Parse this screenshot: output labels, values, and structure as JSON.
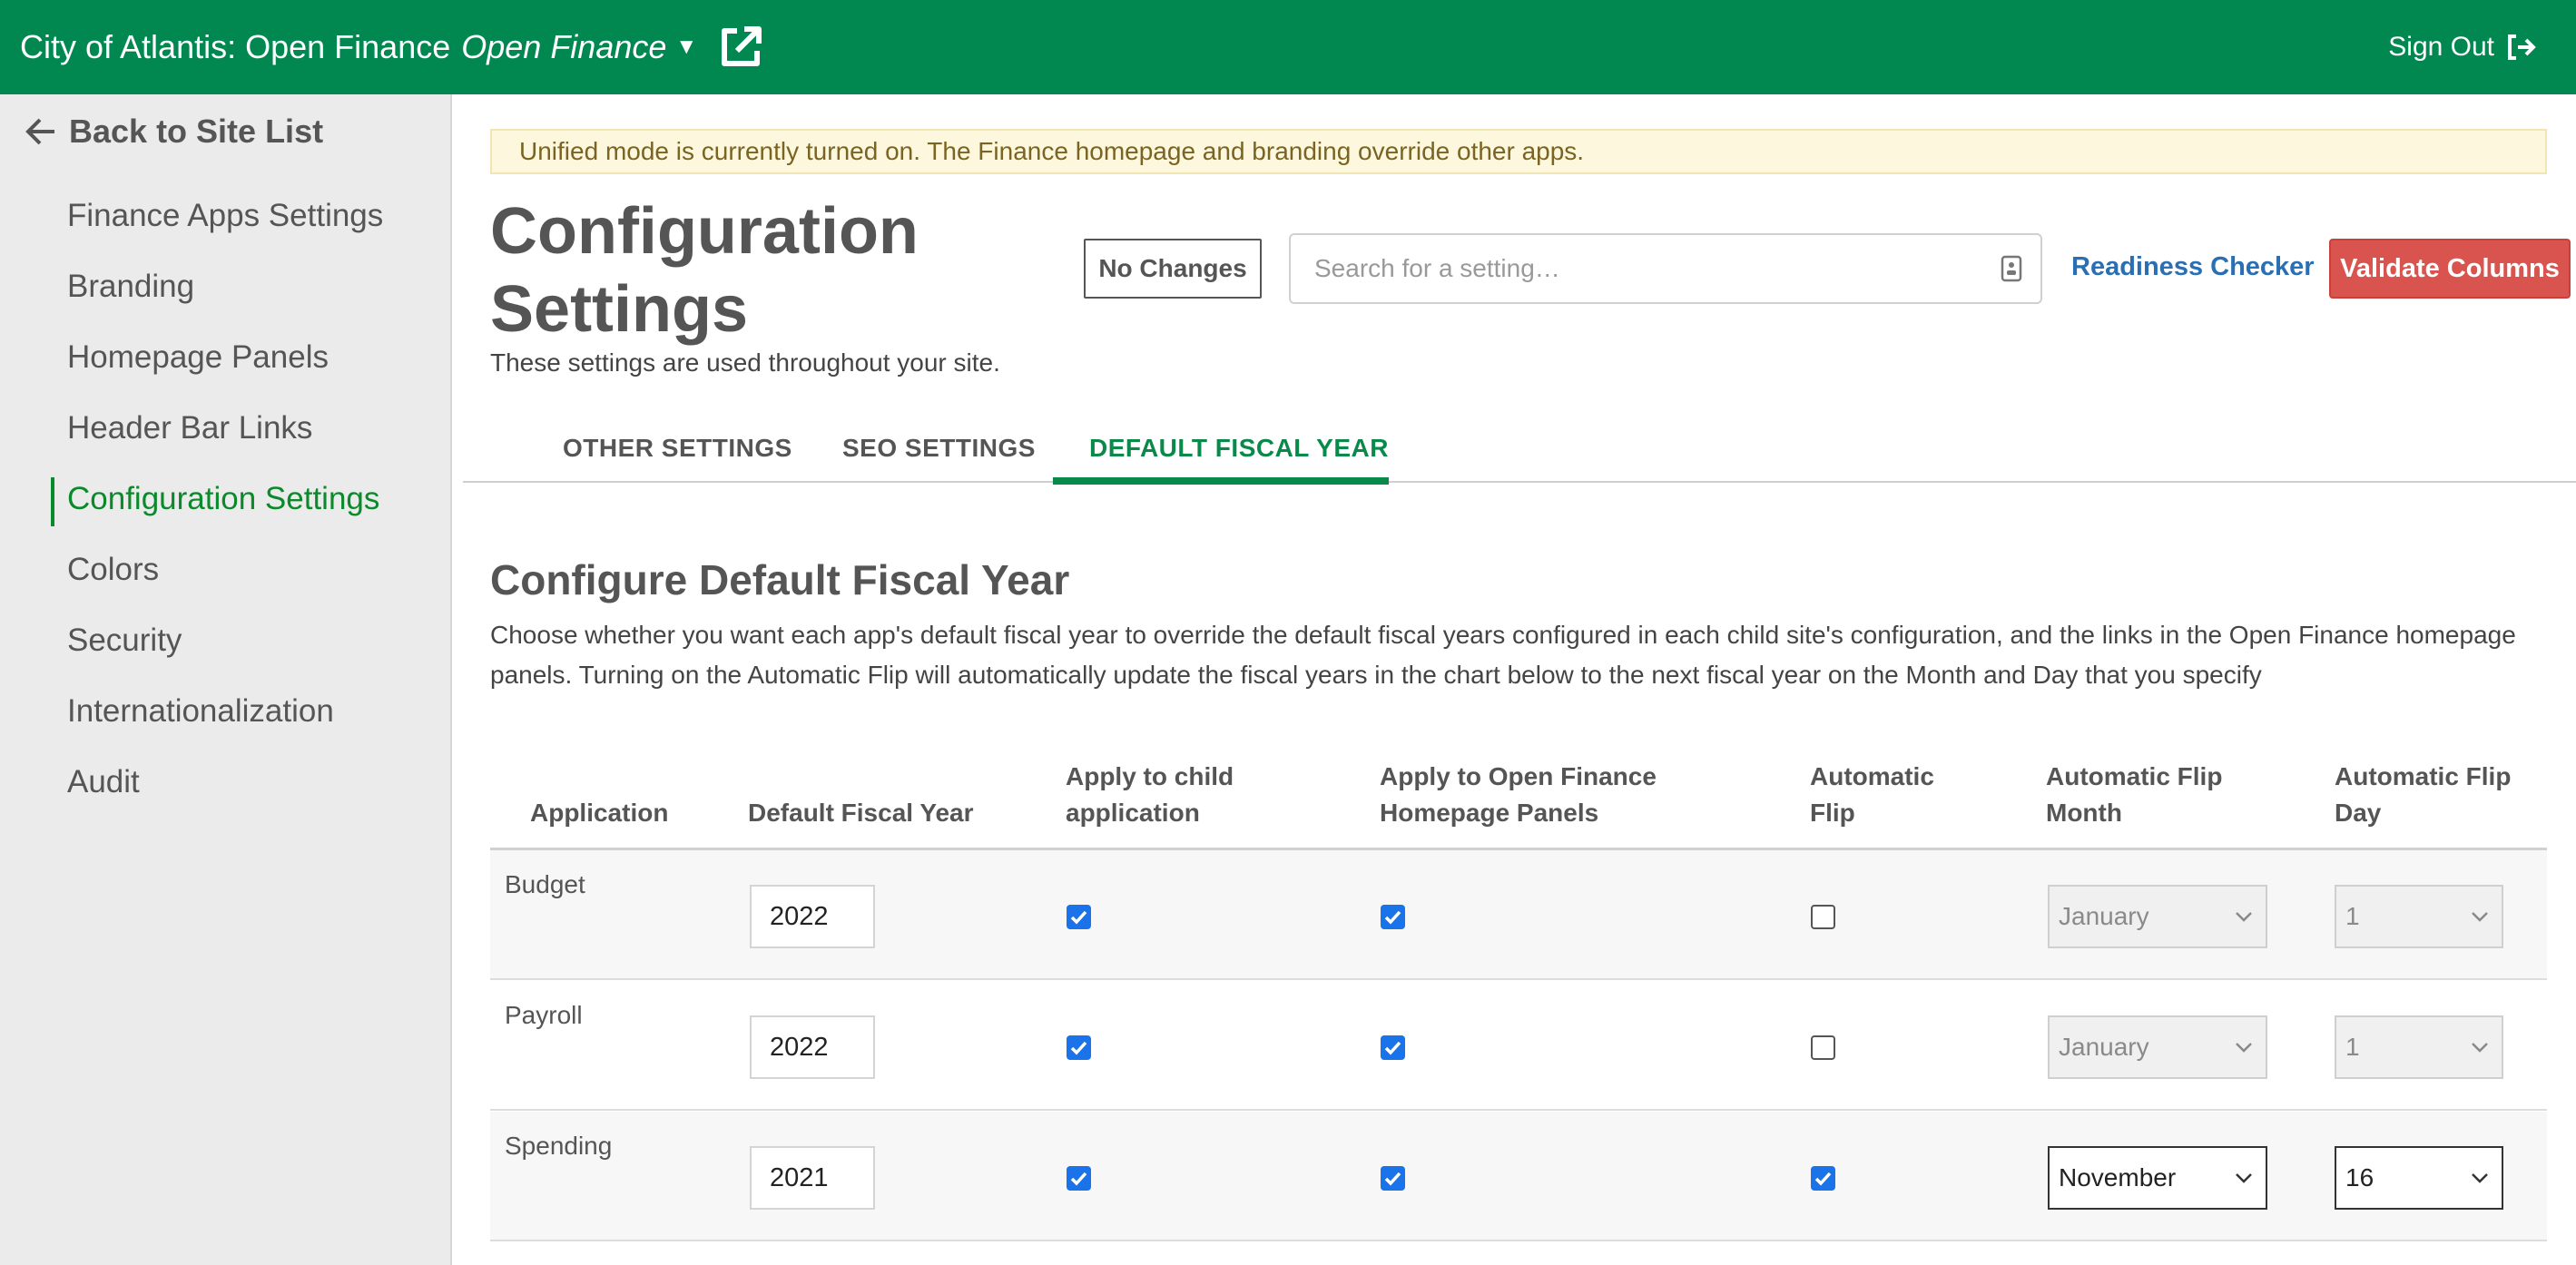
{
  "header": {
    "site_title": "City of Atlantis: Open Finance",
    "app_name": "Open Finance",
    "sign_out": "Sign Out"
  },
  "sidebar": {
    "back_label": "Back to Site List",
    "items": [
      {
        "label": "Finance Apps Settings"
      },
      {
        "label": "Branding"
      },
      {
        "label": "Homepage Panels"
      },
      {
        "label": "Header Bar Links"
      },
      {
        "label": "Configuration Settings",
        "active": true
      },
      {
        "label": "Colors"
      },
      {
        "label": "Security"
      },
      {
        "label": "Internationalization"
      },
      {
        "label": "Audit"
      }
    ]
  },
  "banner": {
    "text": "Unified mode is currently turned on. The Finance homepage and branding override other apps."
  },
  "page": {
    "title": "Configuration Settings",
    "subtitle": "These settings are used throughout your site."
  },
  "toolbar": {
    "no_changes_label": "No Changes",
    "search_placeholder": "Search for a setting…",
    "readiness_label": "Readiness Checker",
    "validate_label": "Validate Columns"
  },
  "tabs": [
    {
      "label": "OTHER SETTINGS"
    },
    {
      "label": "SEO SETTINGS"
    },
    {
      "label": "DEFAULT FISCAL YEAR",
      "active": true
    }
  ],
  "section": {
    "title": "Configure Default Fiscal Year",
    "description": "Choose whether you want each app's default fiscal year to override the default fiscal years configured in each child site's configuration, and the links in the Open Finance homepage panels. Turning on the Automatic Flip will automatically update the fiscal years in the chart below to the next fiscal year on the Month and Day that you specify"
  },
  "table": {
    "columns": [
      "Application",
      "Default Fiscal Year",
      "Apply to child application",
      "Apply to Open Finance Homepage Panels",
      "Automatic Flip",
      "Automatic Flip Month",
      "Automatic Flip Day"
    ],
    "rows": [
      {
        "application": "Budget",
        "year": "2022",
        "apply_child": true,
        "apply_homepage": true,
        "auto_flip": false,
        "month": "January",
        "day": "1"
      },
      {
        "application": "Payroll",
        "year": "2022",
        "apply_child": true,
        "apply_homepage": true,
        "auto_flip": false,
        "month": "January",
        "day": "1"
      },
      {
        "application": "Spending",
        "year": "2021",
        "apply_child": true,
        "apply_homepage": true,
        "auto_flip": true,
        "month": "November",
        "day": "16"
      }
    ]
  },
  "colors": {
    "header_bg": "#008850",
    "accent_green": "#0a8a4a",
    "link_blue": "#2a6fb3",
    "danger_red": "#d9534f",
    "checkbox_blue": "#1a73e8"
  }
}
